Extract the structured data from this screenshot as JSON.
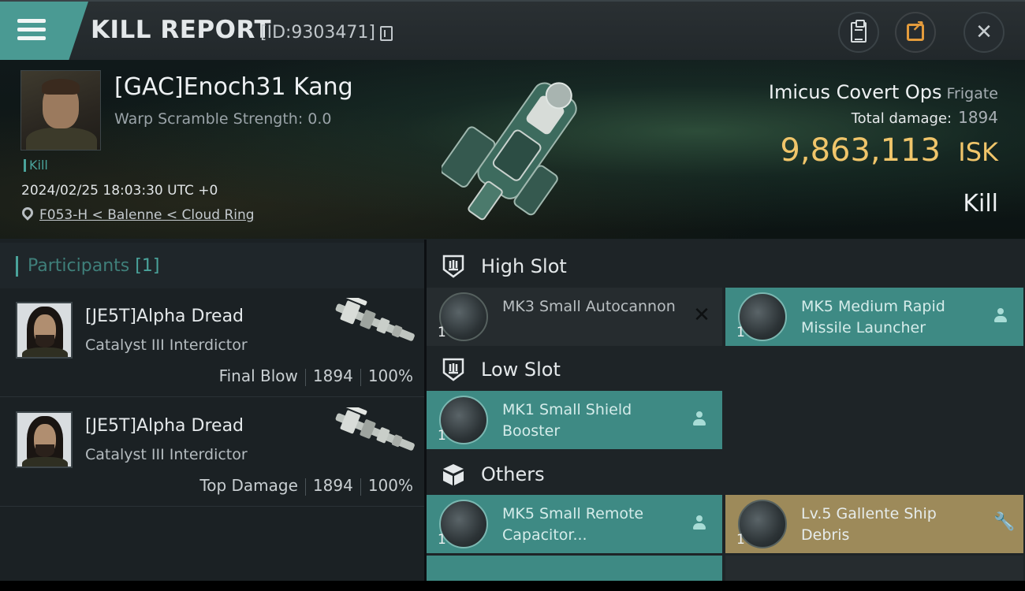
{
  "header": {
    "title": "KILL REPORT",
    "report_id": "[ID:9303471]"
  },
  "victim": {
    "name": "[GAC]Enoch31 Kang",
    "warp_scramble": "Warp Scramble Strength: 0.0",
    "tag": "Kill",
    "timestamp": "2024/02/25 18:03:30 UTC +0",
    "location": "F053-H < Balenne < Cloud Ring",
    "ship_name": "Imicus Covert Ops",
    "ship_class": "Frigate",
    "total_damage_label": "Total damage:",
    "total_damage": "1894",
    "isk_value": "9,863,113",
    "isk_unit": "ISK",
    "result": "Kill"
  },
  "participants": {
    "title": "Participants",
    "count": "[1]",
    "rows": [
      {
        "name": "[JE5T]Alpha Dread",
        "ship": "Catalyst III Interdictor",
        "role": "Final Blow",
        "damage": "1894",
        "percent": "100%"
      },
      {
        "name": "[JE5T]Alpha Dread",
        "ship": "Catalyst III Interdictor",
        "role": "Top Damage",
        "damage": "1894",
        "percent": "100%"
      }
    ]
  },
  "modules": {
    "high_slot": {
      "title": "High Slot",
      "items": [
        {
          "qty": "1",
          "name": "MK3 Small Autocannon",
          "state": "destroyed",
          "icon": "autocannon-icon"
        },
        {
          "qty": "1",
          "name": "MK5 Medium Rapid Missile Launcher",
          "state": "dropped",
          "icon": "missile-launcher-icon"
        }
      ]
    },
    "low_slot": {
      "title": "Low Slot",
      "items": [
        {
          "qty": "1",
          "name": "MK1 Small Shield Booster",
          "state": "dropped",
          "icon": "shield-booster-icon"
        }
      ]
    },
    "others": {
      "title": "Others",
      "items": [
        {
          "qty": "1",
          "name": "MK5 Small Remote Capacitor...",
          "state": "dropped",
          "icon": "remote-capacitor-icon"
        },
        {
          "qty": "1",
          "name": "Lv.5 Gallente Ship Debris",
          "state": "salvage",
          "icon": "ship-debris-icon"
        }
      ]
    }
  },
  "colors": {
    "accent_teal": "#4aa39b",
    "isk_gold": "#f0c56a",
    "share_orange": "#e39b3c"
  }
}
